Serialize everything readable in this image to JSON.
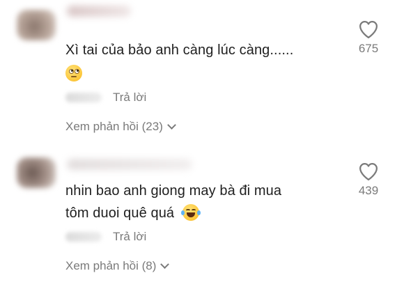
{
  "comments": [
    {
      "text": "Xì tai của bảo anh càng lúc càng......",
      "emoji": "face-with-rolling-eyes",
      "reply_label": "Trả lời",
      "view_replies": "Xem phản hồi (23)",
      "likes": "675",
      "icon": "heart-icon"
    },
    {
      "text_line1": "nhin bao anh giong may bà đi mua",
      "text_line2": "tôm duoi quê quá",
      "emoji": "face-with-tears-of-joy",
      "reply_label": "Trả lời",
      "view_replies": "Xem phản hồi (8)",
      "likes": "439",
      "icon": "heart-icon"
    }
  ]
}
